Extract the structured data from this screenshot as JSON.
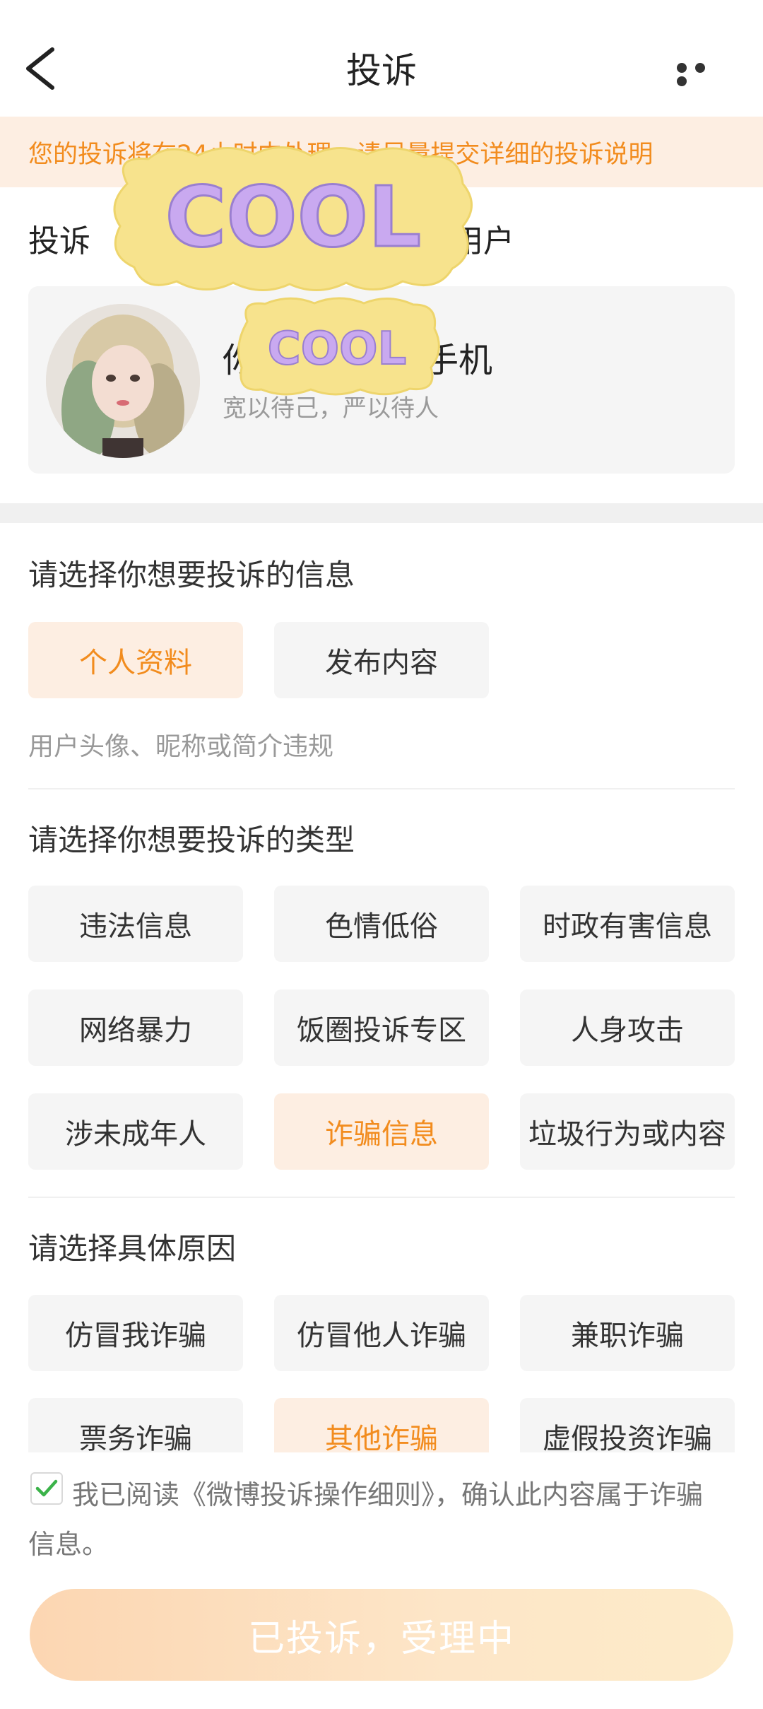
{
  "header": {
    "title": "投诉"
  },
  "notice": {
    "text": "您的投诉将在24小时内处理，请尽量提交详细的投诉说明"
  },
  "target": {
    "label_prefix": "投诉",
    "label_suffix": "用户",
    "user_name": "你",
    "user_name_suffix": "儿手机",
    "bio": "宽以待己，严以待人"
  },
  "sticker": {
    "text": "COOL"
  },
  "info_section": {
    "title": "请选择你想要投诉的信息",
    "options": [
      {
        "label": "个人资料",
        "selected": true
      },
      {
        "label": "发布内容",
        "selected": false
      }
    ],
    "hint": "用户头像、昵称或简介违规"
  },
  "type_section": {
    "title": "请选择你想要投诉的类型",
    "options": [
      {
        "label": "违法信息",
        "selected": false
      },
      {
        "label": "色情低俗",
        "selected": false
      },
      {
        "label": "时政有害信息",
        "selected": false
      },
      {
        "label": "网络暴力",
        "selected": false
      },
      {
        "label": "饭圈投诉专区",
        "selected": false
      },
      {
        "label": "人身攻击",
        "selected": false
      },
      {
        "label": "涉未成年人",
        "selected": false
      },
      {
        "label": "诈骗信息",
        "selected": true
      },
      {
        "label": "垃圾行为或内容",
        "selected": false
      }
    ]
  },
  "reason_section": {
    "title": "请选择具体原因",
    "options": [
      {
        "label": "仿冒我诈骗",
        "selected": false
      },
      {
        "label": "仿冒他人诈骗",
        "selected": false
      },
      {
        "label": "兼职诈骗",
        "selected": false
      },
      {
        "label": "票务诈骗",
        "selected": false
      },
      {
        "label": "其他诈骗",
        "selected": true
      },
      {
        "label": "虚假投资诈骗",
        "selected": false
      }
    ]
  },
  "agreement": {
    "checked": true,
    "text": "我已阅读《微博投诉操作细则》，确认此内容属于诈骗信息。"
  },
  "submit": {
    "label": "已投诉，受理中"
  },
  "colors": {
    "accent": "#f28c1e",
    "accent_bg": "#fdeee2",
    "chip_bg": "#f5f5f5",
    "check_green": "#3bb34a"
  }
}
